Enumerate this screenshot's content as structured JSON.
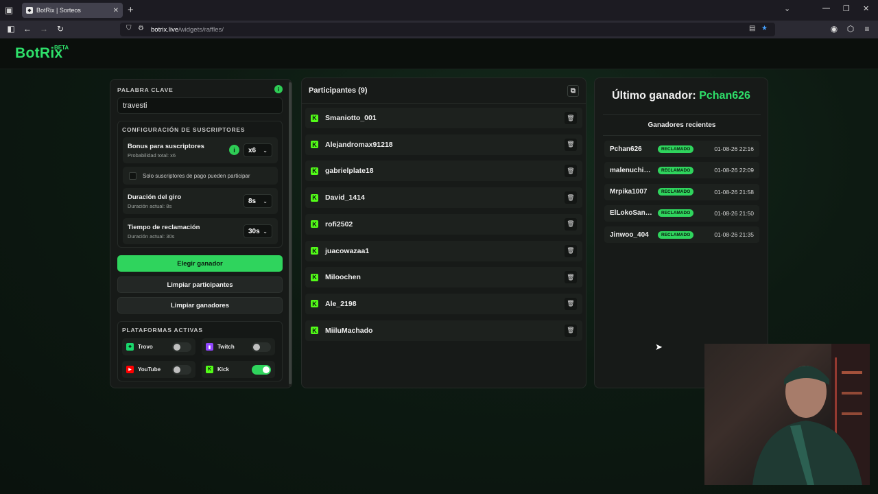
{
  "browser": {
    "tab_title": "BotRix | Sorteos",
    "tab_close": "✕",
    "new_tab": "+",
    "url_host": "botrix.live",
    "url_path": "/widgets/raffles/"
  },
  "app": {
    "logo": "BotRix",
    "beta": "BETA"
  },
  "left_panel": {
    "keyword_label": "PALABRA CLAVE",
    "keyword_value": "travesti",
    "sub_config_label": "CONFIGURACIÓN DE SUSCRIPTORES",
    "bonus_title": "Bonus para suscriptores",
    "bonus_sub": "Probabilidad total: x6",
    "bonus_value": "x6",
    "paid_only_label": "Solo suscriptores de pago pueden participar",
    "spin_title": "Duración del giro",
    "spin_sub": "Duración actual: 8s",
    "spin_value": "8s",
    "claim_title": "Tiempo de reclamación",
    "claim_sub": "Duración actual: 30s",
    "claim_value": "30s",
    "btn_pick": "Elegir ganador",
    "btn_clear_participants": "Limpiar participantes",
    "btn_clear_winners": "Limpiar ganadores",
    "platforms_label": "PLATAFORMAS ACTIVAS",
    "platforms": [
      {
        "name": "Trovo",
        "enabled": false,
        "icon": "trovo-icon",
        "color": "#19d66b"
      },
      {
        "name": "Twitch",
        "enabled": false,
        "icon": "twitch-icon",
        "color": "#9146ff"
      },
      {
        "name": "YouTube",
        "enabled": false,
        "icon": "youtube-icon",
        "color": "#ff0000"
      },
      {
        "name": "Kick",
        "enabled": true,
        "icon": "kick-icon",
        "color": "#53fc18"
      }
    ]
  },
  "participants": {
    "title": "Participantes (9)",
    "list": [
      "Smaniotto_001",
      "Alejandromax91218",
      "gabrielplate18",
      "David_1414",
      "rofi2502",
      "juacowazaa1",
      "Miloochen",
      "Ale_2198",
      "MiiluMachado"
    ]
  },
  "winners": {
    "last_label": "Último ganador:",
    "last_name": "Pchan626",
    "recent_title": "Ganadores recientes",
    "list": [
      {
        "name": "Pchan626",
        "badge": "RECLAMADO",
        "time": "01-08-26 22:16"
      },
      {
        "name": "malenuchi2…",
        "badge": "RECLAMADO",
        "time": "01-08-26 22:09"
      },
      {
        "name": "Mrpika1007",
        "badge": "RECLAMADO",
        "time": "01-08-26 21:58"
      },
      {
        "name": "ElLokoSant…",
        "badge": "RECLAMADO",
        "time": "01-08-26 21:50"
      },
      {
        "name": "Jinwoo_404",
        "badge": "RECLAMADO",
        "time": "01-08-26 21:35"
      }
    ]
  },
  "colors": {
    "accent": "#2ee06a",
    "kick": "#53fc18"
  }
}
